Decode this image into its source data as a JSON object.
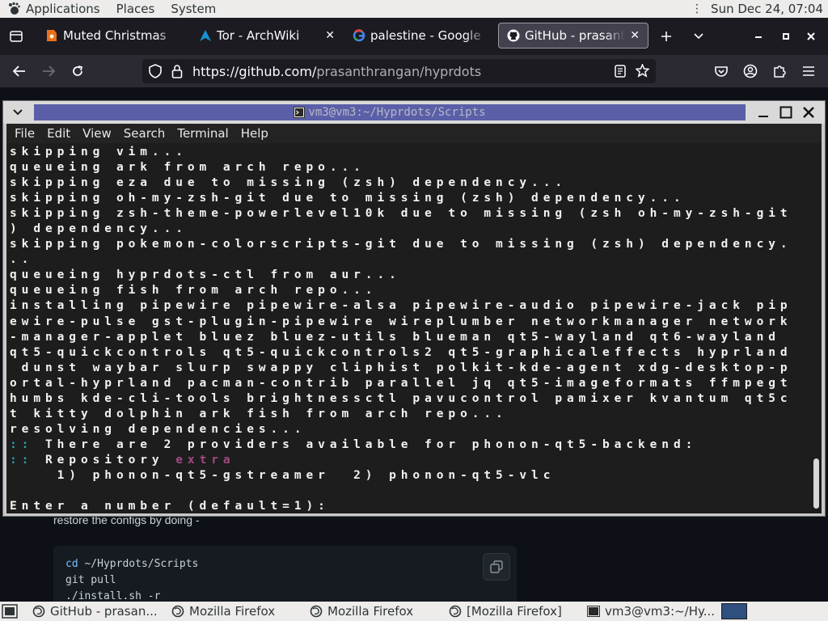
{
  "gnome_panel": {
    "menus": [
      "Applications",
      "Places",
      "System"
    ],
    "clock": "Sun Dec 24, 07:04"
  },
  "firefox": {
    "tabs": [
      {
        "title": "Muted Christmas",
        "favicon": "orange-tag-icon"
      },
      {
        "title": "Tor - ArchWiki",
        "favicon": "arch-logo-icon"
      },
      {
        "title": "palestine - Google",
        "favicon": "google-g-icon"
      },
      {
        "title": "GitHub - prasanth",
        "favicon": "github-icon",
        "active": true
      }
    ],
    "url": {
      "host": "https://github.com/",
      "path": "prasanthrangan/hyprdots"
    }
  },
  "webpage": {
    "restore_text": "restore the configs by doing -",
    "code_lines": [
      "cd ~/Hyprdots/Scripts",
      "git pull",
      "./install.sh -r"
    ]
  },
  "terminal": {
    "title": "vm3@vm3:~/Hyprdots/Scripts",
    "menu": [
      "File",
      "Edit",
      "View",
      "Search",
      "Terminal",
      "Help"
    ],
    "lines": [
      {
        "segments": [
          {
            "t": "skipping vim..."
          }
        ]
      },
      {
        "segments": [
          {
            "t": "queueing ark from arch repo..."
          }
        ]
      },
      {
        "segments": [
          {
            "t": "skipping eza due to missing (zsh) dependency..."
          }
        ]
      },
      {
        "segments": [
          {
            "t": "skipping oh-my-zsh-git due to missing (zsh) dependency..."
          }
        ]
      },
      {
        "segments": [
          {
            "t": "skipping zsh-theme-powerlevel10k due to missing (zsh oh-my-zsh-git"
          }
        ]
      },
      {
        "segments": [
          {
            "t": ") dependency..."
          }
        ]
      },
      {
        "segments": [
          {
            "t": "skipping pokemon-colorscripts-git due to missing (zsh) dependency."
          }
        ]
      },
      {
        "segments": [
          {
            "t": ".."
          }
        ]
      },
      {
        "segments": [
          {
            "t": "queueing hyprdots-ctl from aur..."
          }
        ]
      },
      {
        "segments": [
          {
            "t": "queueing fish from arch repo..."
          }
        ]
      },
      {
        "segments": [
          {
            "t": "installing pipewire pipewire-alsa pipewire-audio pipewire-jack pip"
          }
        ]
      },
      {
        "segments": [
          {
            "t": "ewire-pulse gst-plugin-pipewire wireplumber networkmanager network"
          }
        ]
      },
      {
        "segments": [
          {
            "t": "-manager-applet bluez bluez-utils blueman qt5-wayland qt6-wayland "
          }
        ]
      },
      {
        "segments": [
          {
            "t": "qt5-quickcontrols qt5-quickcontrols2 qt5-graphicaleffects hyprland"
          }
        ]
      },
      {
        "segments": [
          {
            "t": " dunst waybar slurp swappy cliphist polkit-kde-agent xdg-desktop-p"
          }
        ]
      },
      {
        "segments": [
          {
            "t": "ortal-hyprland pacman-contrib parallel jq qt5-imageformats ffmpegt"
          }
        ]
      },
      {
        "segments": [
          {
            "t": "humbs kde-cli-tools brightnessctl pavucontrol pamixer kvantum qt5c"
          }
        ]
      },
      {
        "segments": [
          {
            "t": "t kitty dolphin ark fish from arch repo..."
          }
        ]
      },
      {
        "segments": [
          {
            "t": "resolving dependencies..."
          }
        ]
      },
      {
        "segments": [
          {
            "t": "::",
            "c": "cyan"
          },
          {
            "t": " There are 2 providers available for phonon-qt5-backend:"
          }
        ]
      },
      {
        "segments": [
          {
            "t": "::",
            "c": "cyan"
          },
          {
            "t": " Repository "
          },
          {
            "t": "extra",
            "c": "purple"
          }
        ]
      },
      {
        "segments": [
          {
            "t": "    1) phonon-qt5-gstreamer  2) phonon-qt5-vlc"
          }
        ]
      },
      {
        "segments": [
          {
            "t": ""
          }
        ]
      },
      {
        "segments": [
          {
            "t": "Enter a number (default=1):"
          }
        ]
      }
    ]
  },
  "taskbar": {
    "tasks": [
      {
        "label": "GitHub - prasan...",
        "icon": "firefox-icon"
      },
      {
        "label": "Mozilla Firefox",
        "icon": "firefox-icon"
      },
      {
        "label": "Mozilla Firefox",
        "icon": "firefox-icon"
      },
      {
        "label": "[Mozilla Firefox]",
        "icon": "firefox-icon"
      },
      {
        "label": "vm3@vm3:~/Hy...",
        "icon": "terminal-icon"
      }
    ]
  }
}
